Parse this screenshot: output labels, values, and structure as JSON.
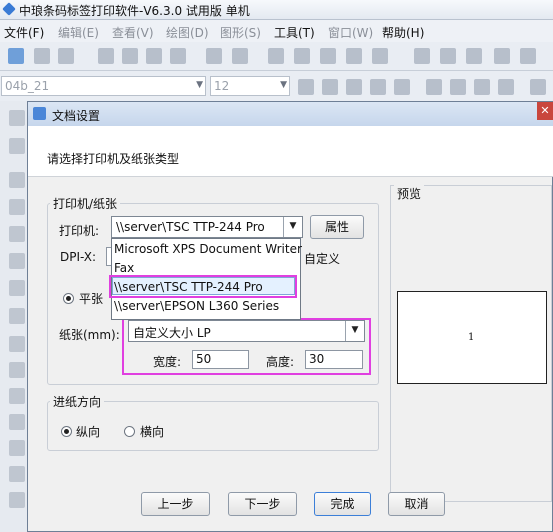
{
  "app": {
    "title": "中琅条码标签打印软件-V6.3.0 试用版 单机"
  },
  "menu": [
    {
      "label": "文件(F)",
      "enabled": true
    },
    {
      "label": "编辑(E)",
      "enabled": false
    },
    {
      "label": "查看(V)",
      "enabled": false
    },
    {
      "label": "绘图(D)",
      "enabled": false
    },
    {
      "label": "图形(S)",
      "enabled": false
    },
    {
      "label": "工具(T)",
      "enabled": true
    },
    {
      "label": "窗口(W)",
      "enabled": false
    },
    {
      "label": "帮助(H)",
      "enabled": true
    }
  ],
  "toolbar2": {
    "font_name": "04b_21",
    "font_size": "12"
  },
  "dialog": {
    "title": "文档设置",
    "close_label": "✕",
    "header": "请选择打印机及纸张类型",
    "printer_group": {
      "legend": "打印机/纸张",
      "printer_label": "打印机:",
      "printer_value": "\\\\server\\TSC TTP-244 Pro",
      "properties_button": "属性",
      "dpi_label": "DPI-X:",
      "custom_label": "自定义",
      "radio_label": "平张",
      "paper_label": "纸张(mm):",
      "paper_value": "自定义大小 LP",
      "width_label": "宽度:",
      "width_value": "50",
      "height_label": "高度:",
      "height_value": "30"
    },
    "printer_options": [
      "Microsoft XPS Document Writer",
      "Fax",
      "\\\\server\\TSC TTP-244 Pro",
      "\\\\server\\EPSON L360 Series"
    ],
    "feed_group": {
      "legend": "进纸方向",
      "portrait": "纵向",
      "landscape": "横向",
      "selected": "纵向"
    },
    "preview": {
      "legend": "预览",
      "page_number": "1"
    },
    "buttons": {
      "prev": "上一步",
      "next": "下一步",
      "finish": "完成",
      "cancel": "取消"
    }
  },
  "colors": {
    "highlight": "#e03fe0",
    "title_blue": "#c6d6ec"
  }
}
